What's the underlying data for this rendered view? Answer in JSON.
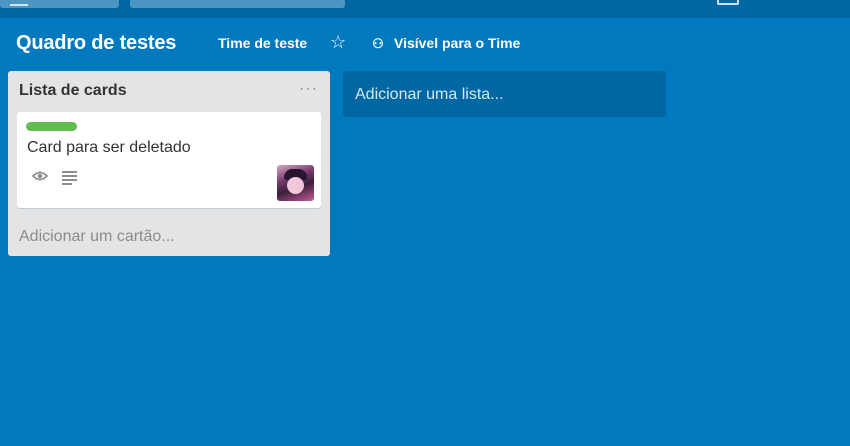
{
  "board": {
    "title": "Quadro de testes",
    "team": "Time de teste",
    "visibility": "Visível para o Time",
    "star_icon": "star-icon",
    "visibility_icon": "team-icon",
    "background_color": "#0079bf"
  },
  "lists": [
    {
      "title": "Lista de cards",
      "menu_icon": "ellipsis-icon",
      "cards": [
        {
          "title": "Card para ser deletado",
          "label_color": "#61bd4f",
          "badges": [
            "eye-icon",
            "description-icon"
          ],
          "member_avatar": "avatar"
        }
      ],
      "add_card": "Adicionar um cartão..."
    }
  ],
  "add_list": "Adicionar uma lista..."
}
